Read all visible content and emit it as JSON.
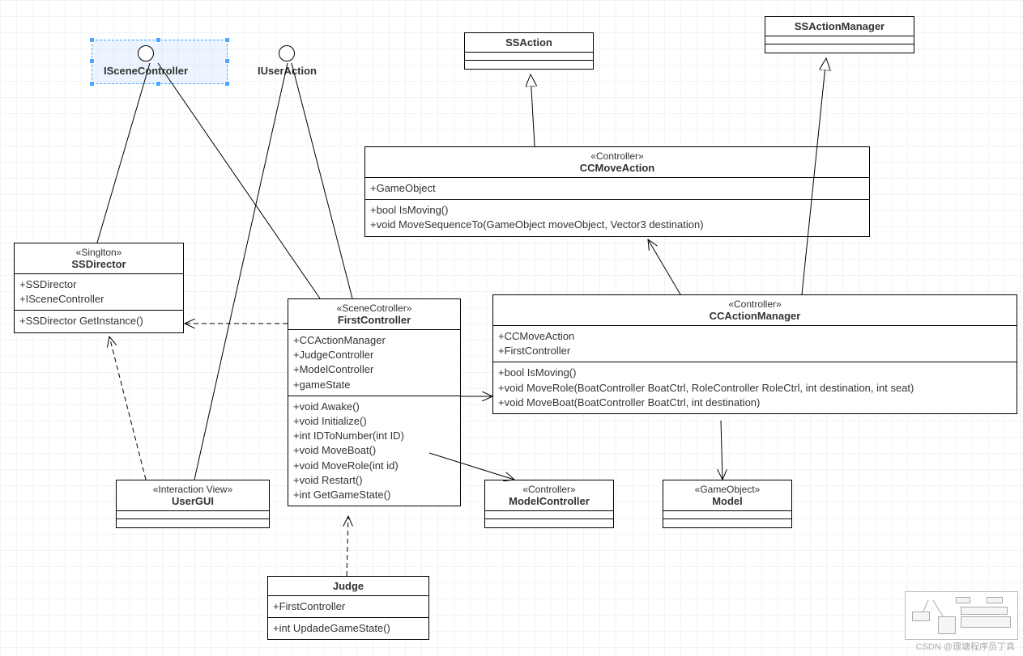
{
  "interfaces": {
    "isceneController": {
      "label": "ISceneController"
    },
    "iuserAction": {
      "label": "IUserAction"
    }
  },
  "classes": {
    "ssaction": {
      "stereotype": "",
      "name": "SSAction"
    },
    "ssactionManager": {
      "stereotype": "",
      "name": "SSActionManager"
    },
    "ssdirector": {
      "stereotype": "«Singlton»",
      "name": "SSDirector",
      "attrs": [
        "+SSDirector",
        "+ISceneController"
      ],
      "ops": [
        "+SSDirector GetInstance()"
      ]
    },
    "firstController": {
      "stereotype": "«SceneCotroller»",
      "name": "FirstController",
      "attrs": [
        "+CCActionManager",
        "+JudgeController",
        "+ModelController",
        "+gameState"
      ],
      "ops": [
        "+void Awake()",
        "+void Initialize()",
        "+int IDToNumber(int ID)",
        "+void MoveBoat()",
        "+void MoveRole(int id)",
        "+void Restart()",
        "+int GetGameState()"
      ]
    },
    "ccmoveAction": {
      "stereotype": "«Controller»",
      "name": "CCMoveAction",
      "attrs": [
        "+GameObject"
      ],
      "ops": [
        "+bool IsMoving()",
        "+void MoveSequenceTo(GameObject moveObject, Vector3 destination)"
      ]
    },
    "ccactionManager": {
      "stereotype": "«Controller»",
      "name": "CCActionManager",
      "attrs": [
        "+CCMoveAction",
        "+FirstController"
      ],
      "ops": [
        "+bool IsMoving()",
        "+void MoveRole(BoatController BoatCtrl, RoleController RoleCtrl, int destination, int seat)",
        "+void MoveBoat(BoatController BoatCtrl, int destination)"
      ]
    },
    "userGUI": {
      "stereotype": "«Interaction View»",
      "name": "UserGUI"
    },
    "modelController": {
      "stereotype": "«Controller»",
      "name": "ModelController"
    },
    "model": {
      "stereotype": "«GameObject»",
      "name": "Model"
    },
    "judge": {
      "stereotype": "",
      "name": "Judge",
      "attrs": [
        "+FirstController"
      ],
      "ops": [
        "+int UpdadeGameState()"
      ]
    }
  },
  "watermark": "CSDN @理塘程序员丁真"
}
